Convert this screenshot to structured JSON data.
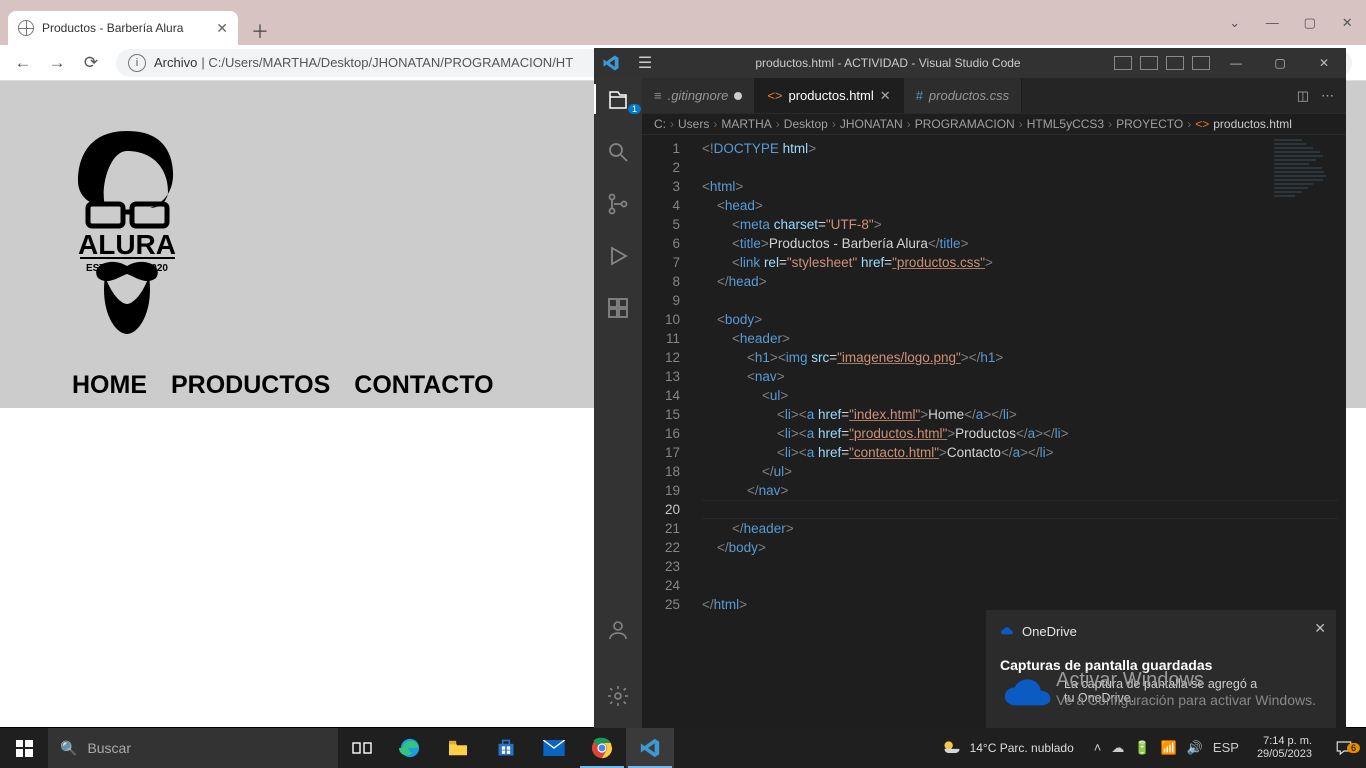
{
  "chrome": {
    "tab_title": "Productos - Barbería Alura",
    "toolbar": {
      "archivo_label": "Archivo",
      "url": "C:/Users/MARTHA/Desktop/JHONATAN/PROGRAMACION/HT"
    },
    "page": {
      "logo_text_top": "ALURA",
      "logo_estd": "ESTD",
      "logo_year": "2020",
      "nav": [
        "HOME",
        "PRODUCTOS",
        "CONTACTO"
      ]
    }
  },
  "vscode": {
    "title": "productos.html - ACTIVIDAD - Visual Studio Code",
    "tabs": [
      {
        "label": ".gitingnore",
        "dirty": true,
        "icon_color": "#8a8a8a"
      },
      {
        "label": "productos.html",
        "active": true,
        "icon_color": "#e37933"
      },
      {
        "label": "productos.css",
        "icon_color": "#519aba"
      }
    ],
    "breadcrumb": [
      "C:",
      "Users",
      "MARTHA",
      "Desktop",
      "JHONATAN",
      "PROGRAMACION",
      "HTML5yCCS3",
      "PROYECTO",
      "productos.html"
    ],
    "activity_badge": "1",
    "code": {
      "lines": [
        {
          "n": 1,
          "html": "<span class='c-gray'>&lt;!</span><span class='c-blue'>DOCTYPE</span> <span class='c-lblue'>html</span><span class='c-gray'>&gt;</span>"
        },
        {
          "n": 2,
          "html": ""
        },
        {
          "n": 3,
          "html": "<span class='c-gray'>&lt;</span><span class='c-blue'>html</span><span class='c-gray'>&gt;</span>"
        },
        {
          "n": 4,
          "html": "    <span class='c-gray'>&lt;</span><span class='c-blue'>head</span><span class='c-gray'>&gt;</span>"
        },
        {
          "n": 5,
          "html": "        <span class='c-gray'>&lt;</span><span class='c-blue'>meta</span> <span class='c-lblue'>charset</span>=<span class='c-str'>\"UTF-8\"</span><span class='c-gray'>&gt;</span>"
        },
        {
          "n": 6,
          "html": "        <span class='c-gray'>&lt;</span><span class='c-blue'>title</span><span class='c-gray'>&gt;</span><span class='c-white'>Productos - Barbería Alura</span><span class='c-gray'>&lt;/</span><span class='c-blue'>title</span><span class='c-gray'>&gt;</span>"
        },
        {
          "n": 7,
          "html": "        <span class='c-gray'>&lt;</span><span class='c-blue'>link</span> <span class='c-lblue'>rel</span>=<span class='c-str'>\"stylesheet\"</span> <span class='c-lblue'>href</span>=<span class='c-str c-und'>\"productos.css\"</span><span class='c-gray'>&gt;</span>"
        },
        {
          "n": 8,
          "html": "    <span class='c-gray'>&lt;/</span><span class='c-blue'>head</span><span class='c-gray'>&gt;</span>"
        },
        {
          "n": 9,
          "html": ""
        },
        {
          "n": 10,
          "html": "    <span class='c-gray'>&lt;</span><span class='c-blue'>body</span><span class='c-gray'>&gt;</span>"
        },
        {
          "n": 11,
          "html": "        <span class='c-gray'>&lt;</span><span class='c-blue'>header</span><span class='c-gray'>&gt;</span>"
        },
        {
          "n": 12,
          "html": "            <span class='c-gray'>&lt;</span><span class='c-blue'>h1</span><span class='c-gray'>&gt;&lt;</span><span class='c-blue'>img</span> <span class='c-lblue'>src</span>=<span class='c-str c-und'>\"imagenes/logo.png\"</span><span class='c-gray'>&gt;&lt;/</span><span class='c-blue'>h1</span><span class='c-gray'>&gt;</span>"
        },
        {
          "n": 13,
          "html": "            <span class='c-gray'>&lt;</span><span class='c-blue'>nav</span><span class='c-gray'>&gt;</span>"
        },
        {
          "n": 14,
          "html": "                <span class='c-gray'>&lt;</span><span class='c-blue'>ul</span><span class='c-gray'>&gt;</span>"
        },
        {
          "n": 15,
          "html": "                    <span class='c-gray'>&lt;</span><span class='c-blue'>li</span><span class='c-gray'>&gt;&lt;</span><span class='c-blue'>a</span> <span class='c-lblue'>href</span>=<span class='c-str c-und'>\"index.html\"</span><span class='c-gray'>&gt;</span><span class='c-white'>Home</span><span class='c-gray'>&lt;/</span><span class='c-blue'>a</span><span class='c-gray'>&gt;&lt;/</span><span class='c-blue'>li</span><span class='c-gray'>&gt;</span>"
        },
        {
          "n": 16,
          "html": "                    <span class='c-gray'>&lt;</span><span class='c-blue'>li</span><span class='c-gray'>&gt;&lt;</span><span class='c-blue'>a</span> <span class='c-lblue'>href</span>=<span class='c-str c-und'>\"productos.html\"</span><span class='c-gray'>&gt;</span><span class='c-white'>Productos</span><span class='c-gray'>&lt;/</span><span class='c-blue'>a</span><span class='c-gray'>&gt;&lt;/</span><span class='c-blue'>li</span><span class='c-gray'>&gt;</span>"
        },
        {
          "n": 17,
          "html": "                    <span class='c-gray'>&lt;</span><span class='c-blue'>li</span><span class='c-gray'>&gt;&lt;</span><span class='c-blue'>a</span> <span class='c-lblue'>href</span>=<span class='c-str c-und'>\"contacto.html\"</span><span class='c-gray'>&gt;</span><span class='c-white'>Contacto</span><span class='c-gray'>&lt;/</span><span class='c-blue'>a</span><span class='c-gray'>&gt;&lt;/</span><span class='c-blue'>li</span><span class='c-gray'>&gt;</span>"
        },
        {
          "n": 18,
          "html": "                <span class='c-gray'>&lt;/</span><span class='c-blue'>ul</span><span class='c-gray'>&gt;</span>"
        },
        {
          "n": 19,
          "html": "            <span class='c-gray'>&lt;/</span><span class='c-blue'>nav</span><span class='c-gray'>&gt;</span>"
        },
        {
          "n": 20,
          "html": "            ",
          "current": true
        },
        {
          "n": 21,
          "html": "        <span class='c-gray'>&lt;/</span><span class='c-blue'>header</span><span class='c-gray'>&gt;</span>"
        },
        {
          "n": 22,
          "html": "    <span class='c-gray'>&lt;/</span><span class='c-blue'>body</span><span class='c-gray'>&gt;</span>"
        },
        {
          "n": 23,
          "html": ""
        },
        {
          "n": 24,
          "html": ""
        },
        {
          "n": 25,
          "html": "<span class='c-gray'>&lt;/</span><span class='c-blue'>html</span><span class='c-gray'>&gt;</span>"
        }
      ]
    }
  },
  "toast": {
    "brand": "OneDrive",
    "title": "Capturas de pantalla guardadas",
    "body1": "La captura de pantalla se agregó a",
    "body2": "tu OneDrive."
  },
  "watermark": {
    "line1": "Activar Windows",
    "line2": "Ve a Configuración para activar Windows."
  },
  "taskbar": {
    "search_placeholder": "Buscar",
    "weather": "14°C  Parc. nublado",
    "lang": "ESP",
    "time": "7:14 p. m.",
    "date": "29/05/2023",
    "notif_count": "6"
  }
}
